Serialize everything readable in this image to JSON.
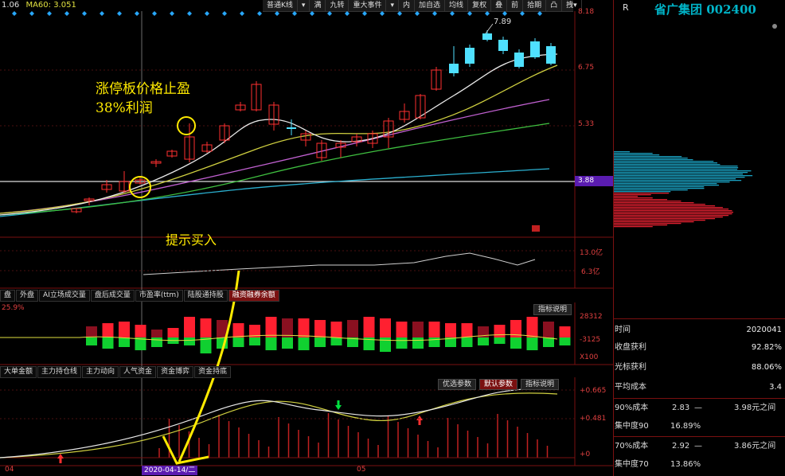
{
  "ma_header": [
    {
      "text": "1.06",
      "color": "#e0e0e0"
    },
    {
      "text": "MA60: 3.051",
      "color": "#e0e040"
    }
  ],
  "toolbar": [
    "普通K线",
    "▾",
    "满",
    "九转",
    "重大事件",
    "▾",
    "内",
    "加自选",
    "均线",
    "复权",
    "叠",
    "前",
    "拾期",
    "凸",
    "拽▾"
  ],
  "price_axis": [
    "8.18",
    "6.75",
    "5.33",
    "3.88"
  ],
  "price_axis_highlight": "3.88",
  "high_label": "7.89",
  "annotation_main": [
    "涨停板价格止盈",
    "38%利润"
  ],
  "annotation_buy": "提示买入",
  "volume_axis": [
    "13.0亿",
    "6.3亿"
  ],
  "tabs_top": [
    "盘",
    "外盘",
    "AI立场成交量",
    "盘后成交量",
    "市盈率(ttm)",
    "陆股通持股",
    "融资融券余额"
  ],
  "tabs_top_active": 6,
  "indicator_btn_1": "指标说明",
  "macd_header": "25.9%",
  "macd_axis": [
    "28312",
    "-3125",
    "X100"
  ],
  "tabs_bottom": [
    "大单金额",
    "主力持仓线",
    "主力动向",
    "人气资金",
    "资金博弈",
    "资金持底"
  ],
  "bottom_btns": [
    "优选参数",
    "默认参数",
    "指标说明"
  ],
  "bottom_btns_active": 1,
  "bottom_axis": [
    "+0.665",
    "+0.481",
    "+0"
  ],
  "date_labels": {
    "left": "04",
    "cursor": "2020-04-14/二",
    "right": "05"
  },
  "right_panel": {
    "r_label": "R",
    "title": "省广集团 002400",
    "rows": [
      {
        "k": "时间",
        "v": "2020041"
      },
      {
        "k": "收盘获利",
        "v": "92.82%"
      },
      {
        "k": "光标获利",
        "v": "88.06%"
      },
      {
        "k": "平均成本",
        "v": "3.4"
      }
    ],
    "cost90": {
      "k": "90%成本",
      "a": "2.83",
      "b": "3.98元之间"
    },
    "conc90": {
      "k": "集中度90",
      "v": "16.89%"
    },
    "cost70": {
      "k": "70%成本",
      "a": "2.92",
      "b": "3.86元之间"
    },
    "conc70": {
      "k": "集中度70",
      "v": "13.86%"
    }
  },
  "colors": {
    "up": "#ff3030",
    "down": "#4fe0ff",
    "axis": "#e04040",
    "yellow": "#ffea00"
  }
}
